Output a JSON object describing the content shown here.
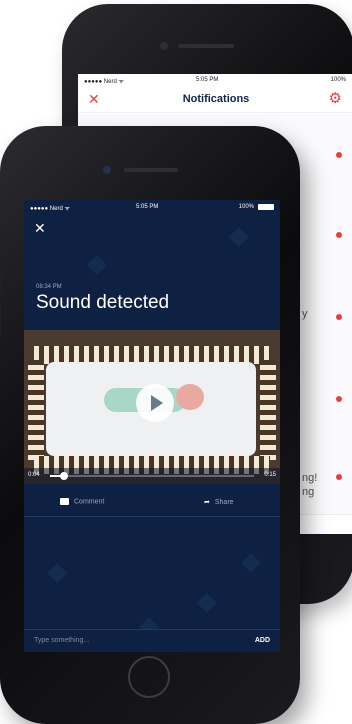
{
  "back_phone": {
    "status": {
      "carrier": "●●●●● Nerd ᯤ",
      "time": "5:05 PM",
      "battery": "100%"
    },
    "header": {
      "title": "Notifications",
      "close_icon": "close-icon",
      "settings_icon": "gear-icon"
    },
    "fragments": [
      "y",
      "ng!",
      "ng"
    ],
    "accent": "#e8413c"
  },
  "front_phone": {
    "status": {
      "carrier": "●●●●● Nerd ᯤ",
      "time": "5:05 PM",
      "battery": "100%"
    },
    "close_icon": "close-icon",
    "event": {
      "time": "08:34 PM",
      "title": "Sound detected"
    },
    "video": {
      "time_start": "0:04",
      "time_end": "0:15",
      "play_icon": "play-icon",
      "progress": 0.08
    },
    "actions": {
      "comment": "Comment",
      "share": "Share"
    },
    "input": {
      "placeholder": "Type something...",
      "add": "ADD"
    },
    "background": "#0f2142"
  }
}
